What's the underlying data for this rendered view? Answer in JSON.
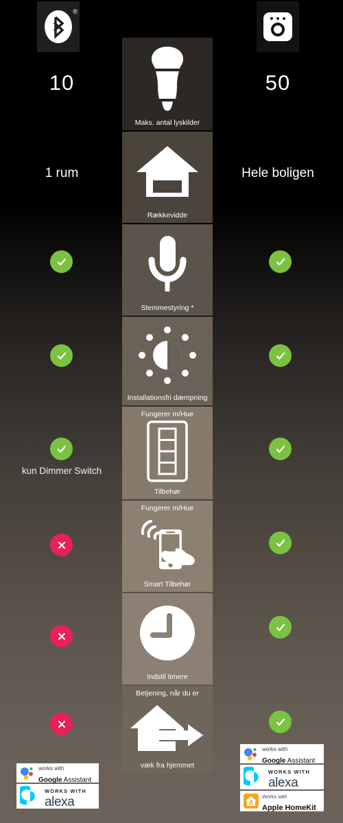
{
  "header": {
    "left_icon": "bluetooth-icon",
    "left_trademark": "®",
    "right_icon": "hue-bridge-icon"
  },
  "columns": {
    "left": {
      "max_lights": "10",
      "range": "1 rum",
      "accessories_note": "kun Dimmer Switch"
    },
    "right": {
      "max_lights": "50",
      "range": "Hele boligen"
    }
  },
  "features": [
    {
      "id": "max-lights",
      "icon": "light-bulb-icon",
      "label": "Maks. antal lyskilder",
      "top_label": "",
      "left_value": "10",
      "right_value": "50",
      "left_state": "value",
      "right_state": "value"
    },
    {
      "id": "range",
      "icon": "house-icon",
      "label": "Rækkevidde",
      "top_label": "",
      "left_value": "1 rum",
      "right_value": "Hele boligen",
      "left_state": "value",
      "right_state": "value"
    },
    {
      "id": "voice-control",
      "icon": "microphone-icon",
      "label": "Stemmestyring *",
      "top_label": "",
      "left_state": "yes",
      "right_state": "yes"
    },
    {
      "id": "wireless-dimming",
      "icon": "brightness-icon",
      "label": "Installationsfri dæmpning",
      "top_label": "",
      "left_state": "yes",
      "right_state": "yes"
    },
    {
      "id": "accessories",
      "icon": "dimmer-switch-icon",
      "label": "Tilbehør",
      "top_label": "Fungerer m/Hue",
      "left_state": "yes",
      "left_note": "kun Dimmer Switch",
      "right_state": "yes"
    },
    {
      "id": "smart-accessories",
      "icon": "hand-phone-wifi-icon",
      "label": "Smart Tilbehør",
      "top_label": "Fungerer m/Hue",
      "left_state": "no",
      "right_state": "yes"
    },
    {
      "id": "timers",
      "icon": "clock-icon",
      "label": "Indstil timere",
      "top_label": "",
      "left_state": "no",
      "right_state": "yes"
    },
    {
      "id": "away-from-home",
      "icon": "house-arrow-icon",
      "label": "væk fra hjemmet",
      "top_label": "Betjening, når du er",
      "left_state": "no",
      "right_state": "yes"
    }
  ],
  "badges": {
    "yes_glyph": "checkmark",
    "no_glyph": "cross",
    "yes_color": "#7cc242",
    "no_color": "#e8205c"
  },
  "logos": {
    "left": [
      {
        "id": "google-assistant",
        "line1": "works with",
        "line2_bold": "Google",
        "line2_rest": " Assistant"
      },
      {
        "id": "alexa",
        "line1": "WORKS WITH",
        "line2": "alexa"
      }
    ],
    "right": [
      {
        "id": "google-assistant",
        "line1": "works with",
        "line2_bold": "Google",
        "line2_rest": " Assistant"
      },
      {
        "id": "alexa",
        "line1": "WORKS WITH",
        "line2": "alexa"
      },
      {
        "id": "apple-homekit",
        "line1": "Works with",
        "line2": "Apple HomeKit"
      }
    ]
  }
}
